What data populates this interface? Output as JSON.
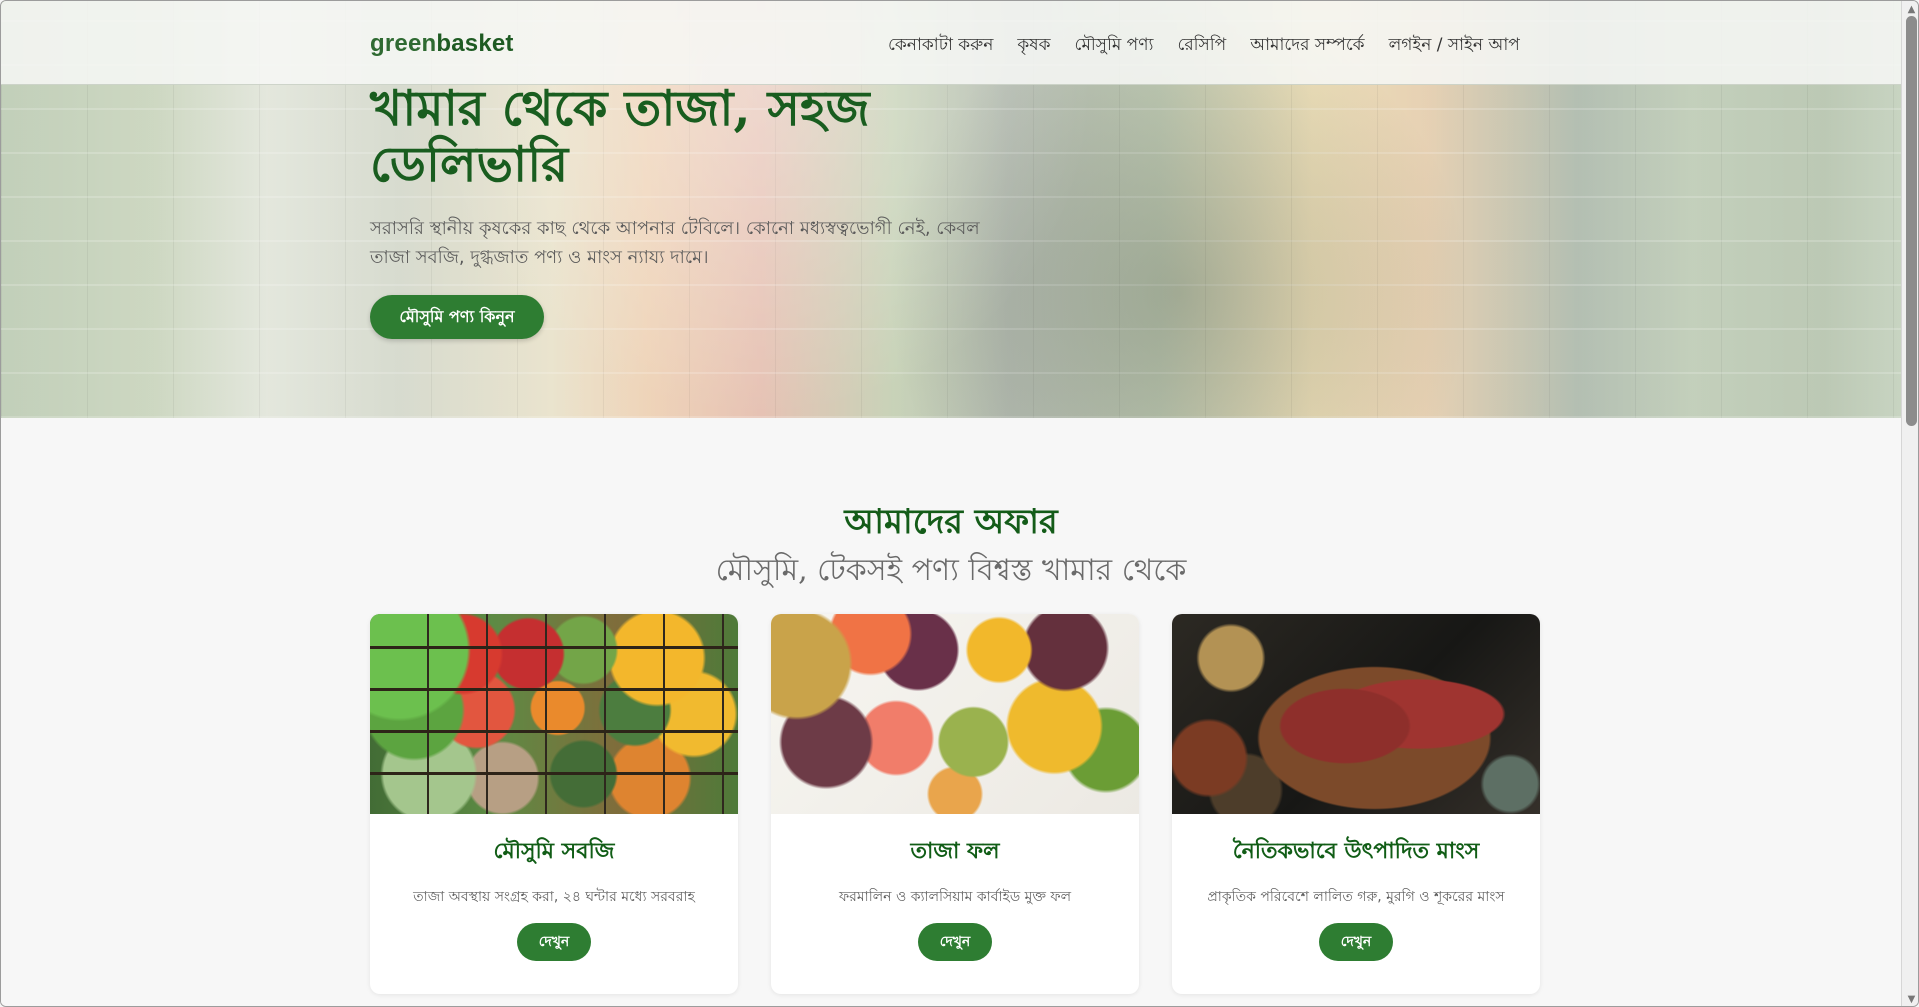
{
  "header": {
    "logo_prefix": "green",
    "logo_suffix": "basket",
    "nav": [
      {
        "label": "কেনাকাটা করুন"
      },
      {
        "label": "কৃষক"
      },
      {
        "label": "মৌসুমি পণ্য"
      },
      {
        "label": "রেসিপি"
      },
      {
        "label": "আমাদের সম্পর্কে"
      },
      {
        "label": "লগইন / সাইন আপ"
      }
    ]
  },
  "hero": {
    "title": "খামার থেকে তাজা, সহজ ডেলিভারি",
    "subtitle": "সরাসরি স্থানীয় কৃষকের কাছ থেকে আপনার টেবিলে। কোনো মধ্যস্বত্বভোগী নেই, কেবল তাজা সবজি, দুগ্ধজাত পণ্য ও মাংস ন্যায্য দামে।",
    "button": "মৌসুমি পণ্য কিনুন"
  },
  "offers": {
    "title": "আমাদের অফার",
    "subtitle": "মৌসুমি, টেকসই পণ্য বিশ্বস্ত খামার থেকে",
    "cards": [
      {
        "title": "মৌসুমি সবজি",
        "description": "তাজা অবস্থায় সংগ্রহ করা, ২৪ ঘন্টার মধ্যে সরবরাহ",
        "button": "দেখুন"
      },
      {
        "title": "তাজা ফল",
        "description": "ফরমালিন ও ক্যালসিয়াম কার্বাইড মুক্ত ফল",
        "button": "দেখুন"
      },
      {
        "title": "নৈতিকভাবে উৎপাদিত মাংস",
        "description": "প্রাকৃতিক পরিবেশে লালিত গরু, মুরগি ও শূকরের মাংস",
        "button": "দেখুন"
      }
    ]
  },
  "colors": {
    "accent": "#2e7d32",
    "heading": "#195d1f"
  },
  "icons": {
    "scroll_up": "scroll-up-arrow-icon",
    "scroll_down": "scroll-down-arrow-icon"
  }
}
